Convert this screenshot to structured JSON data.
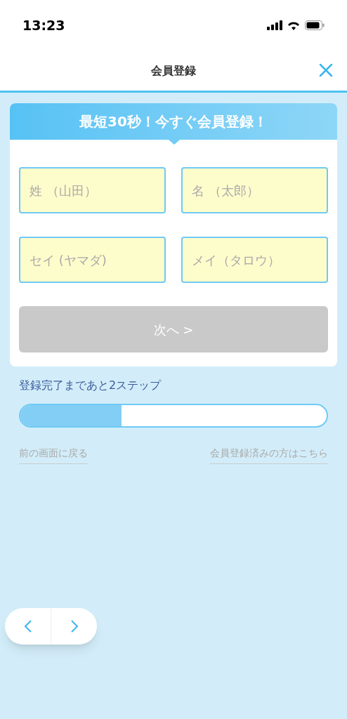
{
  "status_bar": {
    "time": "13:23"
  },
  "header": {
    "title": "会員登録"
  },
  "banner": {
    "title": "最短30秒！今すぐ会員登録！"
  },
  "fields": [
    {
      "placeholder": "姓 （山田）"
    },
    {
      "placeholder": "名 （太郎）"
    },
    {
      "placeholder": "セイ (ヤマダ)"
    },
    {
      "placeholder": "メイ（タロウ）"
    }
  ],
  "next_button": {
    "label": "次へ >",
    "disabled": true
  },
  "progress": {
    "label": "登録完了まであと2ステップ",
    "level": 0.33
  },
  "links": [
    "前の画面に戻る",
    "会員登録済みの方はこちら"
  ]
}
